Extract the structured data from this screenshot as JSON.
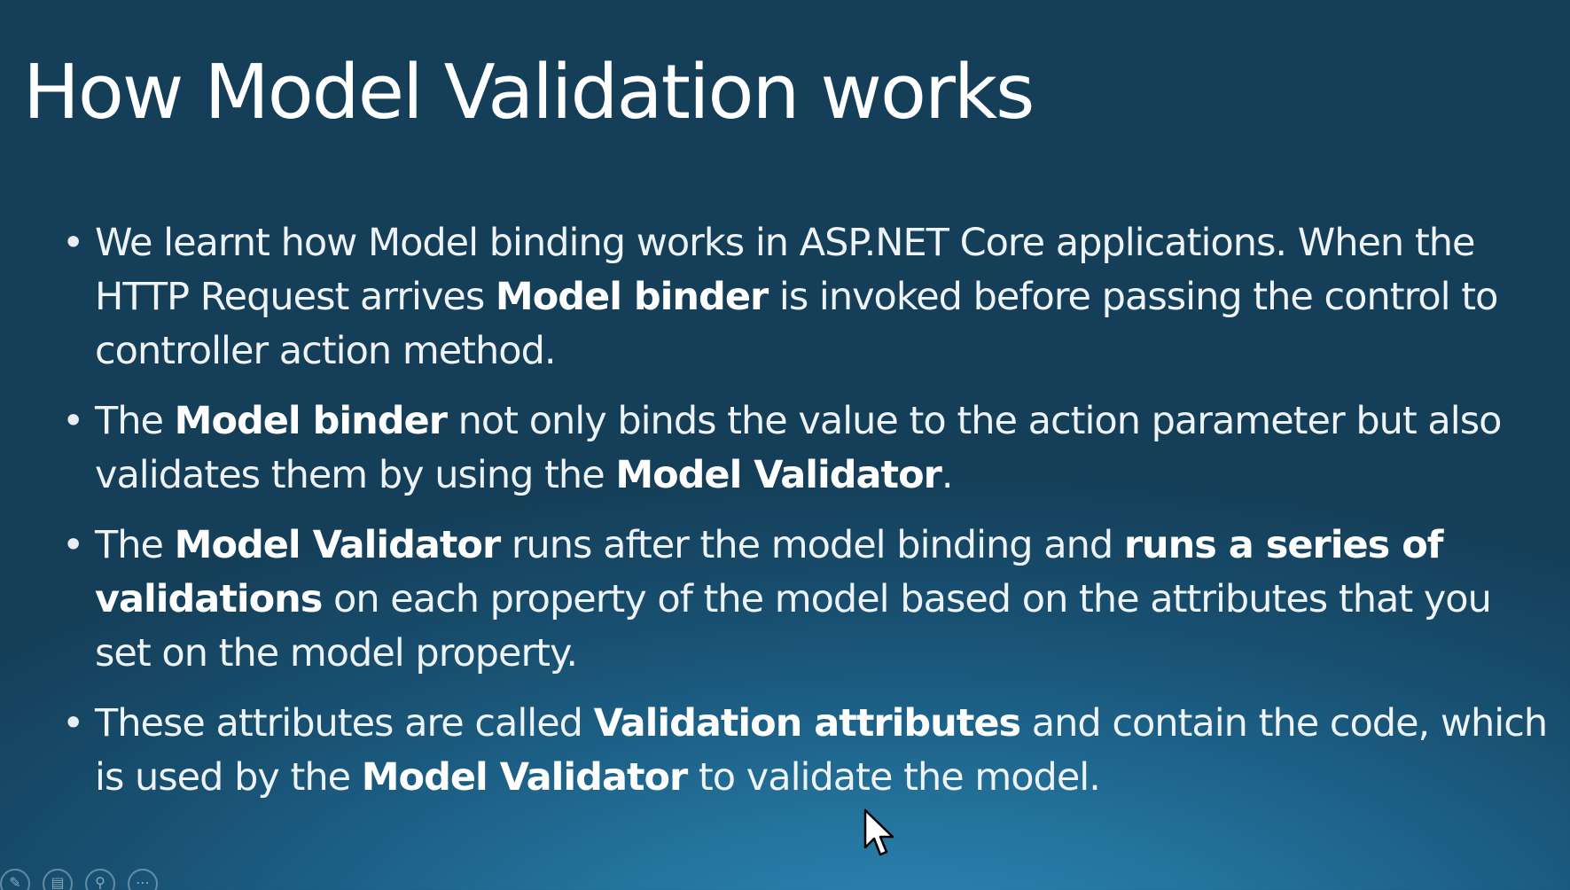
{
  "slide": {
    "title": "How Model Validation works",
    "bullets": [
      {
        "parts": [
          {
            "text": "We learnt how Model binding works in ASP.NET Core applications. When the HTTP Request arrives ",
            "bold": false
          },
          {
            "text": "Model binder",
            "bold": true
          },
          {
            "text": " is invoked before passing the control to controller action method.",
            "bold": false
          }
        ]
      },
      {
        "parts": [
          {
            "text": "The ",
            "bold": false
          },
          {
            "text": "Model binder",
            "bold": true
          },
          {
            "text": " not only binds the value to the action parameter but also validates them by using the ",
            "bold": false
          },
          {
            "text": "Model Validator",
            "bold": true
          },
          {
            "text": ".",
            "bold": false
          }
        ]
      },
      {
        "parts": [
          {
            "text": "The ",
            "bold": false
          },
          {
            "text": "Model Validator",
            "bold": true
          },
          {
            "text": " runs after the model binding and ",
            "bold": false
          },
          {
            "text": "runs a series of validations",
            "bold": true
          },
          {
            "text": " on each property of the model based on the attributes that you set on the model property.",
            "bold": false
          }
        ]
      },
      {
        "parts": [
          {
            "text": "These attributes are called ",
            "bold": false
          },
          {
            "text": "Validation attributes",
            "bold": true
          },
          {
            "text": " and contain the code, which is used by the ",
            "bold": false
          },
          {
            "text": "Model Validator",
            "bold": true
          },
          {
            "text": " to validate the model.",
            "bold": false
          }
        ]
      }
    ]
  },
  "nav_controls": [
    {
      "name": "pen-tool-icon",
      "glyph": "✎"
    },
    {
      "name": "slides-grid-icon",
      "glyph": "▤"
    },
    {
      "name": "zoom-icon",
      "glyph": "⚲"
    },
    {
      "name": "more-options-icon",
      "glyph": "⋯"
    }
  ],
  "colors": {
    "background_dark": "#153f59",
    "background_light": "#2f88b8",
    "text": "#f2f6f8"
  }
}
